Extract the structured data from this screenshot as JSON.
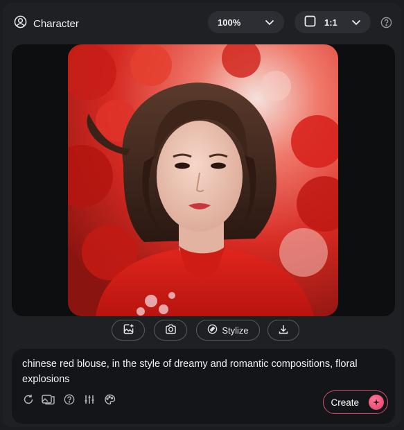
{
  "header": {
    "title": "Character",
    "zoom_value": "100%",
    "aspect_ratio": "1:1"
  },
  "image_actions": {
    "stylize_label": "Stylize"
  },
  "prompt": {
    "text": "chinese red blouse, in the style of dreamy and romantic compositions, floral explosions"
  },
  "create": {
    "label": "Create"
  },
  "colors": {
    "accent": "#e23a62",
    "panel": "#1f2023",
    "canvas": "#0d0e10"
  },
  "icons": [
    "user-circle-icon",
    "chevron-down-icon",
    "square-icon",
    "help-icon",
    "add-image-icon",
    "camera-icon",
    "stylize-icon",
    "download-icon",
    "refresh-icon",
    "image-swap-icon",
    "sliders-icon",
    "palette-icon",
    "sparkle-icon"
  ]
}
